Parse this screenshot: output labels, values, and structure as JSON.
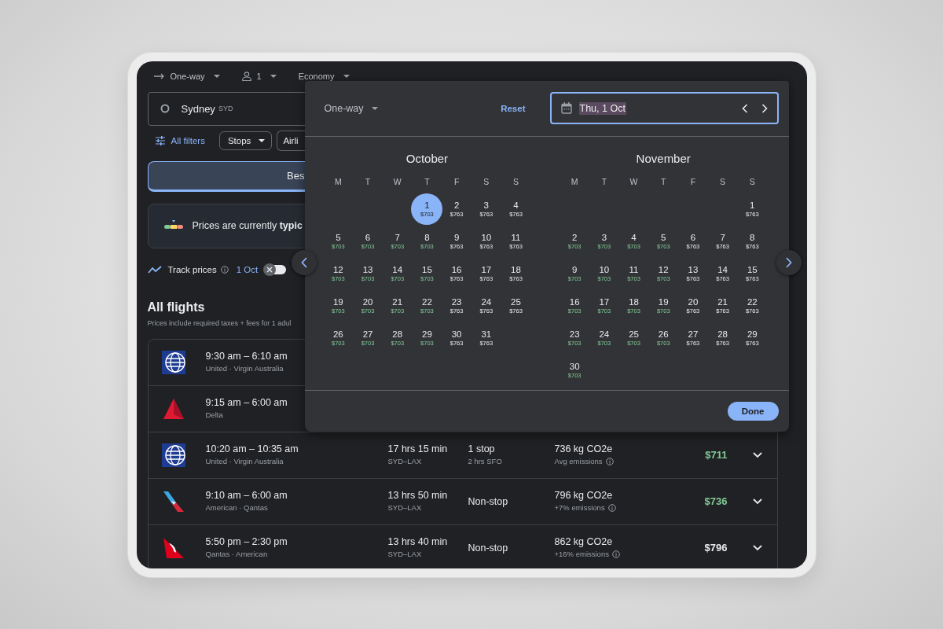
{
  "trip_bar": {
    "trip_type": "One-way",
    "passengers": "1",
    "cabin": "Economy"
  },
  "search": {
    "origin": "Sydney",
    "origin_code": "SYD"
  },
  "filters": {
    "all_filters": "All filters",
    "chips": [
      {
        "label": "Stops",
        "caret": true
      },
      {
        "label": "Airli",
        "caret": false
      }
    ]
  },
  "sort_tabs": [
    {
      "label": "Bes",
      "selected": true
    }
  ],
  "price_insight": {
    "text": "Prices are currently **typic**"
  },
  "track_prices": {
    "label": "Track prices",
    "date": "1 Oct",
    "on": false
  },
  "flights_heading": {
    "title": "All flights",
    "subtitle": "Prices include required taxes + fees for 1 adul"
  },
  "flights": [
    {
      "kind": "globe",
      "times": "9:30 am – 6:10 am",
      "airlines": "United · Virgin Australia"
    },
    {
      "kind": "triangle",
      "times": "9:15 am – 6:00 am",
      "airlines": "Delta"
    },
    {
      "kind": "globe",
      "times": "10:20 am – 10:35 am",
      "airlines": "United · Virgin Australia",
      "duration": "17 hrs 15 min",
      "route": "SYD–LAX",
      "stops": "1 stop",
      "layover": "2 hrs SFO",
      "emissions": "736 kg CO2e",
      "emissions_note": "Avg emissions",
      "price": "$711",
      "price_low": true
    },
    {
      "kind": "stripes",
      "times": "9:10 am – 6:00 am",
      "airlines": "American · Qantas",
      "duration": "13 hrs 50 min",
      "route": "SYD–LAX",
      "stops": "Non-stop",
      "emissions": "796 kg CO2e",
      "emissions_note": "+7% emissions",
      "price": "$736",
      "price_low": true
    },
    {
      "kind": "tail",
      "times": "5:50 pm – 2:30 pm",
      "airlines": "Qantas · American",
      "duration": "13 hrs 40 min",
      "route": "SYD–LAX",
      "stops": "Non-stop",
      "emissions": "862 kg CO2e",
      "emissions_note": "+16% emissions",
      "price": "$796",
      "price_low": false
    }
  ],
  "date_picker": {
    "trip_type": "One-way",
    "reset": "Reset",
    "date_value": "Thu, 1 Oct",
    "date_highlighted": true,
    "done": "Done",
    "months": [
      {
        "name": "October",
        "weekdays": [
          "M",
          "T",
          "W",
          "T",
          "F",
          "S",
          "S"
        ],
        "weeks": [
          [
            {
              "kind": "blank"
            },
            {
              "kind": "blank"
            },
            {
              "kind": "blank"
            },
            {
              "kind": "day",
              "day": "1",
              "price": "$703",
              "low": true,
              "selected": true
            },
            {
              "kind": "day",
              "day": "2",
              "price": "$763",
              "low": false,
              "selected": false
            },
            {
              "kind": "day",
              "day": "3",
              "price": "$763",
              "low": false,
              "selected": false
            },
            {
              "kind": "day",
              "day": "4",
              "price": "$763",
              "low": false,
              "selected": false
            }
          ],
          [
            {
              "kind": "day",
              "day": "5",
              "price": "$703",
              "low": true,
              "selected": false
            },
            {
              "kind": "day",
              "day": "6",
              "price": "$703",
              "low": true,
              "selected": false
            },
            {
              "kind": "day",
              "day": "7",
              "price": "$703",
              "low": true,
              "selected": false
            },
            {
              "kind": "day",
              "day": "8",
              "price": "$703",
              "low": true,
              "selected": false
            },
            {
              "kind": "day",
              "day": "9",
              "price": "$763",
              "low": false,
              "selected": false
            },
            {
              "kind": "day",
              "day": "10",
              "price": "$763",
              "low": false,
              "selected": false
            },
            {
              "kind": "day",
              "day": "11",
              "price": "$763",
              "low": false,
              "selected": false
            }
          ],
          [
            {
              "kind": "day",
              "day": "12",
              "price": "$703",
              "low": true,
              "selected": false
            },
            {
              "kind": "day",
              "day": "13",
              "price": "$703",
              "low": true,
              "selected": false
            },
            {
              "kind": "day",
              "day": "14",
              "price": "$703",
              "low": true,
              "selected": false
            },
            {
              "kind": "day",
              "day": "15",
              "price": "$703",
              "low": true,
              "selected": false
            },
            {
              "kind": "day",
              "day": "16",
              "price": "$763",
              "low": false,
              "selected": false
            },
            {
              "kind": "day",
              "day": "17",
              "price": "$763",
              "low": false,
              "selected": false
            },
            {
              "kind": "day",
              "day": "18",
              "price": "$763",
              "low": false,
              "selected": false
            }
          ],
          [
            {
              "kind": "day",
              "day": "19",
              "price": "$703",
              "low": true,
              "selected": false
            },
            {
              "kind": "day",
              "day": "20",
              "price": "$703",
              "low": true,
              "selected": false
            },
            {
              "kind": "day",
              "day": "21",
              "price": "$703",
              "low": true,
              "selected": false
            },
            {
              "kind": "day",
              "day": "22",
              "price": "$703",
              "low": true,
              "selected": false
            },
            {
              "kind": "day",
              "day": "23",
              "price": "$763",
              "low": false,
              "selected": false
            },
            {
              "kind": "day",
              "day": "24",
              "price": "$763",
              "low": false,
              "selected": false
            },
            {
              "kind": "day",
              "day": "25",
              "price": "$763",
              "low": false,
              "selected": false
            }
          ],
          [
            {
              "kind": "day",
              "day": "26",
              "price": "$703",
              "low": true,
              "selected": false
            },
            {
              "kind": "day",
              "day": "27",
              "price": "$703",
              "low": true,
              "selected": false
            },
            {
              "kind": "day",
              "day": "28",
              "price": "$703",
              "low": true,
              "selected": false
            },
            {
              "kind": "day",
              "day": "29",
              "price": "$703",
              "low": true,
              "selected": false
            },
            {
              "kind": "day",
              "day": "30",
              "price": "$763",
              "low": false,
              "selected": false
            },
            {
              "kind": "day",
              "day": "31",
              "price": "$763",
              "low": false,
              "selected": false
            }
          ]
        ]
      },
      {
        "name": "November",
        "weekdays": [
          "M",
          "T",
          "W",
          "T",
          "F",
          "S",
          "S"
        ],
        "weeks": [
          [
            {
              "kind": "blank"
            },
            {
              "kind": "blank"
            },
            {
              "kind": "blank"
            },
            {
              "kind": "blank"
            },
            {
              "kind": "blank"
            },
            {
              "kind": "blank"
            },
            {
              "kind": "day",
              "day": "1",
              "price": "$763",
              "low": false,
              "selected": false
            }
          ],
          [
            {
              "kind": "day",
              "day": "2",
              "price": "$703",
              "low": true,
              "selected": false
            },
            {
              "kind": "day",
              "day": "3",
              "price": "$703",
              "low": true,
              "selected": false
            },
            {
              "kind": "day",
              "day": "4",
              "price": "$703",
              "low": true,
              "selected": false
            },
            {
              "kind": "day",
              "day": "5",
              "price": "$703",
              "low": true,
              "selected": false
            },
            {
              "kind": "day",
              "day": "6",
              "price": "$763",
              "low": false,
              "selected": false
            },
            {
              "kind": "day",
              "day": "7",
              "price": "$763",
              "low": false,
              "selected": false
            },
            {
              "kind": "day",
              "day": "8",
              "price": "$763",
              "low": false,
              "selected": false
            }
          ],
          [
            {
              "kind": "day",
              "day": "9",
              "price": "$703",
              "low": true,
              "selected": false
            },
            {
              "kind": "day",
              "day": "10",
              "price": "$703",
              "low": true,
              "selected": false
            },
            {
              "kind": "day",
              "day": "11",
              "price": "$703",
              "low": true,
              "selected": false
            },
            {
              "kind": "day",
              "day": "12",
              "price": "$703",
              "low": true,
              "selected": false
            },
            {
              "kind": "day",
              "day": "13",
              "price": "$763",
              "low": false,
              "selected": false
            },
            {
              "kind": "day",
              "day": "14",
              "price": "$763",
              "low": false,
              "selected": false
            },
            {
              "kind": "day",
              "day": "15",
              "price": "$763",
              "low": false,
              "selected": false
            }
          ],
          [
            {
              "kind": "day",
              "day": "16",
              "price": "$703",
              "low": true,
              "selected": false
            },
            {
              "kind": "day",
              "day": "17",
              "price": "$703",
              "low": true,
              "selected": false
            },
            {
              "kind": "day",
              "day": "18",
              "price": "$703",
              "low": true,
              "selected": false
            },
            {
              "kind": "day",
              "day": "19",
              "price": "$703",
              "low": true,
              "selected": false
            },
            {
              "kind": "day",
              "day": "20",
              "price": "$763",
              "low": false,
              "selected": false
            },
            {
              "kind": "day",
              "day": "21",
              "price": "$763",
              "low": false,
              "selected": false
            },
            {
              "kind": "day",
              "day": "22",
              "price": "$763",
              "low": false,
              "selected": false
            }
          ],
          [
            {
              "kind": "day",
              "day": "23",
              "price": "$703",
              "low": true,
              "selected": false
            },
            {
              "kind": "day",
              "day": "24",
              "price": "$703",
              "low": true,
              "selected": false
            },
            {
              "kind": "day",
              "day": "25",
              "price": "$703",
              "low": true,
              "selected": false
            },
            {
              "kind": "day",
              "day": "26",
              "price": "$703",
              "low": true,
              "selected": false
            },
            {
              "kind": "day",
              "day": "27",
              "price": "$763",
              "low": false,
              "selected": false
            },
            {
              "kind": "day",
              "day": "28",
              "price": "$763",
              "low": false,
              "selected": false
            },
            {
              "kind": "day",
              "day": "29",
              "price": "$763",
              "low": false,
              "selected": false
            }
          ],
          [
            {
              "kind": "day",
              "day": "30",
              "price": "$703",
              "low": true,
              "selected": false
            }
          ]
        ]
      }
    ]
  }
}
